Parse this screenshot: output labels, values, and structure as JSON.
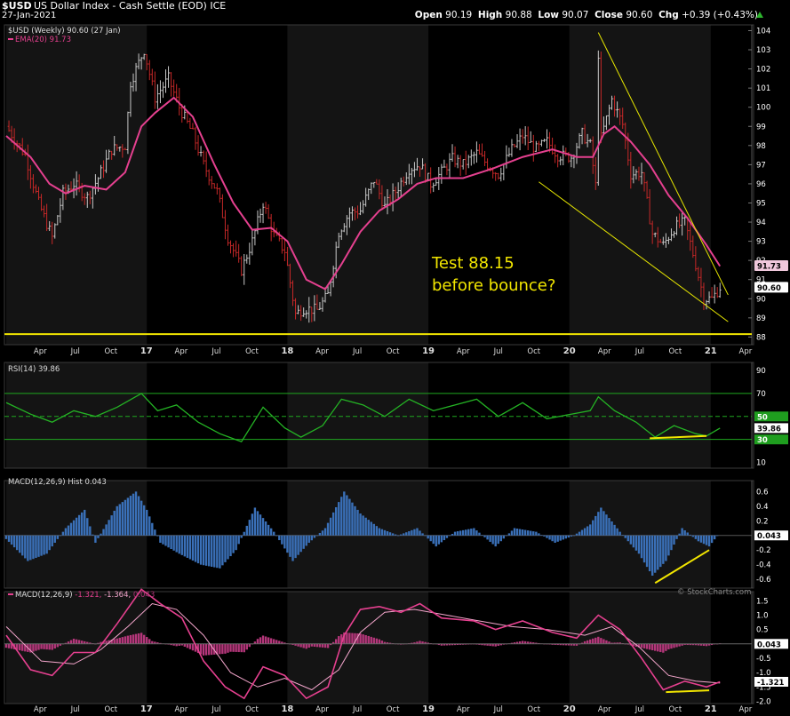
{
  "header": {
    "symbol": "$USD",
    "description": "US Dollar Index - Cash Settle (EOD)",
    "exchange": "ICE",
    "date": "27-Jan-2021",
    "open_label": "Open",
    "open": "90.19",
    "high_label": "High",
    "high": "90.88",
    "low_label": "Low",
    "low": "90.07",
    "close_label": "Close",
    "close": "90.60",
    "chg_label": "Chg",
    "chg": "+0.39 (+0.43%)",
    "watermark": "© StockCharts.com"
  },
  "chart_data": [
    {
      "panel": "price",
      "type": "ohlc-bar",
      "legend": [
        "$USD (Weekly) 90.60 (27 Jan)",
        "EMA(20) 91.73"
      ],
      "yticks": [
        88,
        89,
        90,
        91,
        92,
        93,
        94,
        95,
        96,
        97,
        98,
        99,
        100,
        101,
        102,
        103,
        104
      ],
      "ylim": [
        87.6,
        104.3
      ],
      "x_labels": [
        "Apr",
        "Jul",
        "Oct",
        "17",
        "Apr",
        "Jul",
        "Oct",
        "18",
        "Apr",
        "Jul",
        "Oct",
        "19",
        "Apr",
        "Jul",
        "Oct",
        "20",
        "Apr",
        "Jul",
        "Oct",
        "21",
        "Apr"
      ],
      "last_price_tag": "90.60",
      "ema_tag": "91.73",
      "support_level": 88.15,
      "annotation": [
        "Test 88.15",
        "before bounce?"
      ],
      "close_path": [
        [
          "2016-01-04",
          99.0
        ],
        [
          "2016-02-22",
          97.5
        ],
        [
          "2016-03-28",
          95.0
        ],
        [
          "2016-05-02",
          93.2
        ],
        [
          "2016-05-30",
          95.5
        ],
        [
          "2016-06-27",
          96.0
        ],
        [
          "2016-08-01",
          95.3
        ],
        [
          "2016-08-29",
          96.3
        ],
        [
          "2016-10-03",
          97.8
        ],
        [
          "2016-11-07",
          98.0
        ],
        [
          "2016-11-21",
          101.3
        ],
        [
          "2016-12-26",
          103.0
        ],
        [
          "2017-01-23",
          100.5
        ],
        [
          "2017-02-27",
          101.5
        ],
        [
          "2017-03-27",
          100.0
        ],
        [
          "2017-05-01",
          98.6
        ],
        [
          "2017-05-29",
          97.0
        ],
        [
          "2017-07-03",
          95.6
        ],
        [
          "2017-07-31",
          93.2
        ],
        [
          "2017-09-04",
          91.5
        ],
        [
          "2017-10-02",
          93.0
        ],
        [
          "2017-10-30",
          95.0
        ],
        [
          "2017-11-27",
          93.3
        ],
        [
          "2017-12-25",
          92.5
        ],
        [
          "2018-01-22",
          89.2
        ],
        [
          "2018-02-12",
          89.5
        ],
        [
          "2018-03-19",
          89.4
        ],
        [
          "2018-04-16",
          90.2
        ],
        [
          "2018-05-14",
          93.5
        ],
        [
          "2018-06-11",
          94.5
        ],
        [
          "2018-07-09",
          94.6
        ],
        [
          "2018-08-13",
          96.2
        ],
        [
          "2018-09-10",
          94.8
        ],
        [
          "2018-10-08",
          95.6
        ],
        [
          "2018-11-12",
          96.8
        ],
        [
          "2018-12-10",
          97.0
        ],
        [
          "2019-01-07",
          96.0
        ],
        [
          "2019-02-04",
          96.6
        ],
        [
          "2019-03-04",
          97.3
        ],
        [
          "2019-04-01",
          97.0
        ],
        [
          "2019-05-06",
          97.6
        ],
        [
          "2019-06-03",
          97.0
        ],
        [
          "2019-07-01",
          96.5
        ],
        [
          "2019-08-05",
          97.8
        ],
        [
          "2019-09-02",
          98.5
        ],
        [
          "2019-10-07",
          97.8
        ],
        [
          "2019-11-04",
          98.2
        ],
        [
          "2019-12-02",
          97.5
        ],
        [
          "2020-01-06",
          97.4
        ],
        [
          "2020-02-03",
          98.6
        ],
        [
          "2020-02-24",
          98.0
        ],
        [
          "2020-03-09",
          95.9
        ],
        [
          "2020-03-16",
          102.8
        ],
        [
          "2020-03-23",
          98.4
        ],
        [
          "2020-04-20",
          100.4
        ],
        [
          "2020-05-18",
          99.1
        ],
        [
          "2020-06-08",
          96.5
        ],
        [
          "2020-07-06",
          96.6
        ],
        [
          "2020-08-03",
          93.4
        ],
        [
          "2020-08-31",
          92.8
        ],
        [
          "2020-09-28",
          93.7
        ],
        [
          "2020-10-26",
          94.0
        ],
        [
          "2020-11-23",
          91.8
        ],
        [
          "2020-12-14",
          90.0
        ],
        [
          "2021-01-04",
          90.0
        ],
        [
          "2021-01-25",
          90.6
        ]
      ],
      "ema_path": [
        [
          "2016-01-04",
          98.5
        ],
        [
          "2016-03-07",
          97.4
        ],
        [
          "2016-04-25",
          96.0
        ],
        [
          "2016-06-06",
          95.5
        ],
        [
          "2016-07-25",
          95.9
        ],
        [
          "2016-09-19",
          95.7
        ],
        [
          "2016-11-07",
          96.6
        ],
        [
          "2016-12-19",
          99.0
        ],
        [
          "2017-01-23",
          99.7
        ],
        [
          "2017-03-13",
          100.5
        ],
        [
          "2017-05-01",
          99.5
        ],
        [
          "2017-06-26",
          97.0
        ],
        [
          "2017-08-14",
          95.0
        ],
        [
          "2017-10-02",
          93.6
        ],
        [
          "2017-11-20",
          93.7
        ],
        [
          "2018-01-01",
          93.0
        ],
        [
          "2018-02-19",
          91.0
        ],
        [
          "2018-04-09",
          90.5
        ],
        [
          "2018-05-21",
          91.8
        ],
        [
          "2018-07-09",
          93.5
        ],
        [
          "2018-08-27",
          94.6
        ],
        [
          "2018-10-15",
          95.2
        ],
        [
          "2018-12-03",
          96.0
        ],
        [
          "2019-01-21",
          96.3
        ],
        [
          "2019-04-01",
          96.3
        ],
        [
          "2019-06-17",
          96.8
        ],
        [
          "2019-09-02",
          97.4
        ],
        [
          "2019-11-18",
          97.8
        ],
        [
          "2020-01-20",
          97.4
        ],
        [
          "2020-03-02",
          97.4
        ],
        [
          "2020-03-30",
          98.6
        ],
        [
          "2020-04-27",
          99.0
        ],
        [
          "2020-06-08",
          98.2
        ],
        [
          "2020-07-27",
          97.0
        ],
        [
          "2020-09-14",
          95.4
        ],
        [
          "2020-11-02",
          94.2
        ],
        [
          "2020-12-21",
          92.8
        ],
        [
          "2021-01-25",
          91.7
        ]
      ],
      "trendline_upper": [
        [
          "2020-03-16",
          103.9
        ],
        [
          "2021-02-15",
          90.2
        ]
      ],
      "trendline_lower": [
        [
          "2019-10-14",
          96.1
        ],
        [
          "2021-02-15",
          88.8
        ]
      ]
    },
    {
      "panel": "rsi",
      "type": "line",
      "legend": "RSI(14) 39.86",
      "yticks": [
        10,
        30,
        50,
        70,
        90
      ],
      "ylim": [
        5,
        97
      ],
      "value_tags": [
        "50",
        "39.86",
        "30"
      ],
      "levels": [
        30,
        50,
        70
      ],
      "series": [
        [
          "2016-01-04",
          62
        ],
        [
          "2016-03-07",
          52
        ],
        [
          "2016-05-02",
          45
        ],
        [
          "2016-06-27",
          55
        ],
        [
          "2016-08-22",
          50
        ],
        [
          "2016-10-17",
          58
        ],
        [
          "2016-12-19",
          70
        ],
        [
          "2017-01-30",
          55
        ],
        [
          "2017-03-20",
          60
        ],
        [
          "2017-05-15",
          45
        ],
        [
          "2017-07-10",
          35
        ],
        [
          "2017-09-04",
          28
        ],
        [
          "2017-10-30",
          58
        ],
        [
          "2017-12-25",
          40
        ],
        [
          "2018-02-05",
          32
        ],
        [
          "2018-04-02",
          42
        ],
        [
          "2018-05-21",
          65
        ],
        [
          "2018-07-16",
          60
        ],
        [
          "2018-09-10",
          50
        ],
        [
          "2018-11-12",
          65
        ],
        [
          "2019-01-14",
          55
        ],
        [
          "2019-03-11",
          60
        ],
        [
          "2019-05-06",
          65
        ],
        [
          "2019-07-01",
          50
        ],
        [
          "2019-09-02",
          62
        ],
        [
          "2019-11-04",
          48
        ],
        [
          "2020-01-06",
          52
        ],
        [
          "2020-02-24",
          55
        ],
        [
          "2020-03-16",
          67
        ],
        [
          "2020-04-27",
          55
        ],
        [
          "2020-06-22",
          45
        ],
        [
          "2020-08-10",
          32
        ],
        [
          "2020-09-28",
          42
        ],
        [
          "2020-11-23",
          35
        ],
        [
          "2020-12-21",
          33
        ],
        [
          "2021-01-25",
          39.86
        ]
      ],
      "divergence_segment": [
        [
          "2020-07-27",
          31
        ],
        [
          "2020-12-21",
          33
        ]
      ]
    },
    {
      "panel": "macd_hist",
      "type": "bar",
      "legend": "MACD(12,26,9) Hist 0.043",
      "yticks": [
        -0.6,
        -0.4,
        -0.2,
        0,
        0.2,
        0.4,
        0.6
      ],
      "ylim": [
        -0.72,
        0.75
      ],
      "last_value_tag": "0.043",
      "series": [
        [
          "2016-01-04",
          -0.05
        ],
        [
          "2016-02-29",
          -0.35
        ],
        [
          "2016-04-18",
          -0.25
        ],
        [
          "2016-06-06",
          0.1
        ],
        [
          "2016-07-25",
          0.35
        ],
        [
          "2016-08-22",
          -0.1
        ],
        [
          "2016-10-17",
          0.4
        ],
        [
          "2016-12-05",
          0.6
        ],
        [
          "2017-01-02",
          0.35
        ],
        [
          "2017-02-06",
          -0.1
        ],
        [
          "2017-03-27",
          -0.25
        ],
        [
          "2017-05-22",
          -0.4
        ],
        [
          "2017-07-10",
          -0.45
        ],
        [
          "2017-08-21",
          -0.2
        ],
        [
          "2017-10-09",
          0.38
        ],
        [
          "2017-11-27",
          0.05
        ],
        [
          "2018-01-15",
          -0.35
        ],
        [
          "2018-02-26",
          -0.1
        ],
        [
          "2018-04-09",
          0.1
        ],
        [
          "2018-05-28",
          0.6
        ],
        [
          "2018-07-09",
          0.3
        ],
        [
          "2018-08-27",
          0.1
        ],
        [
          "2018-10-15",
          0.0
        ],
        [
          "2018-12-03",
          0.1
        ],
        [
          "2019-01-21",
          -0.15
        ],
        [
          "2019-03-11",
          0.05
        ],
        [
          "2019-04-29",
          0.1
        ],
        [
          "2019-06-24",
          -0.15
        ],
        [
          "2019-08-12",
          0.1
        ],
        [
          "2019-10-07",
          0.05
        ],
        [
          "2019-11-25",
          -0.1
        ],
        [
          "2020-01-13",
          0.0
        ],
        [
          "2020-02-24",
          0.15
        ],
        [
          "2020-03-23",
          0.38
        ],
        [
          "2020-05-11",
          0.05
        ],
        [
          "2020-06-29",
          -0.25
        ],
        [
          "2020-08-03",
          -0.55
        ],
        [
          "2020-09-07",
          -0.35
        ],
        [
          "2020-10-19",
          0.1
        ],
        [
          "2020-11-30",
          -0.08
        ],
        [
          "2020-12-28",
          -0.15
        ],
        [
          "2021-01-25",
          0.043
        ]
      ],
      "divergence_segment": [
        [
          "2020-08-10",
          -0.65
        ],
        [
          "2020-12-28",
          -0.2
        ]
      ]
    },
    {
      "panel": "macd",
      "type": "line",
      "legend": [
        "MACD(12,26,9)",
        "-1.321",
        "-1.364",
        "0.043"
      ],
      "yticks": [
        -2.0,
        -1.5,
        -1.0,
        -0.5,
        0,
        0.5,
        1.0,
        1.5
      ],
      "ylim": [
        -2.08,
        1.82
      ],
      "value_tags": [
        "0.043",
        "-1.321"
      ],
      "macd": [
        [
          "2016-01-04",
          0.3
        ],
        [
          "2016-03-07",
          -0.9
        ],
        [
          "2016-05-02",
          -1.1
        ],
        [
          "2016-06-27",
          -0.3
        ],
        [
          "2016-08-22",
          -0.3
        ],
        [
          "2016-10-17",
          0.7
        ],
        [
          "2016-12-19",
          1.9
        ],
        [
          "2017-02-06",
          1.4
        ],
        [
          "2017-04-03",
          0.9
        ],
        [
          "2017-05-29",
          -0.6
        ],
        [
          "2017-07-24",
          -1.5
        ],
        [
          "2017-09-11",
          -1.9
        ],
        [
          "2017-10-30",
          -0.8
        ],
        [
          "2017-12-25",
          -1.1
        ],
        [
          "2018-02-19",
          -1.9
        ],
        [
          "2018-04-16",
          -1.5
        ],
        [
          "2018-05-28",
          0.3
        ],
        [
          "2018-07-09",
          1.2
        ],
        [
          "2018-08-27",
          1.3
        ],
        [
          "2018-10-22",
          1.1
        ],
        [
          "2018-12-10",
          1.4
        ],
        [
          "2019-02-04",
          0.9
        ],
        [
          "2019-04-29",
          0.8
        ],
        [
          "2019-06-24",
          0.5
        ],
        [
          "2019-09-02",
          0.8
        ],
        [
          "2019-11-18",
          0.4
        ],
        [
          "2020-01-20",
          0.2
        ],
        [
          "2020-03-16",
          1.0
        ],
        [
          "2020-05-11",
          0.5
        ],
        [
          "2020-07-06",
          -0.5
        ],
        [
          "2020-08-31",
          -1.6
        ],
        [
          "2020-10-26",
          -1.3
        ],
        [
          "2020-12-21",
          -1.5
        ],
        [
          "2021-01-25",
          -1.321
        ]
      ],
      "signal": [
        [
          "2016-01-04",
          0.6
        ],
        [
          "2016-04-04",
          -0.6
        ],
        [
          "2016-06-27",
          -0.7
        ],
        [
          "2016-09-05",
          -0.2
        ],
        [
          "2016-11-14",
          0.6
        ],
        [
          "2017-01-16",
          1.4
        ],
        [
          "2017-03-20",
          1.2
        ],
        [
          "2017-05-29",
          0.3
        ],
        [
          "2017-08-07",
          -1.0
        ],
        [
          "2017-10-16",
          -1.5
        ],
        [
          "2017-12-25",
          -1.2
        ],
        [
          "2018-03-05",
          -1.6
        ],
        [
          "2018-05-14",
          -0.9
        ],
        [
          "2018-07-09",
          0.4
        ],
        [
          "2018-09-10",
          1.1
        ],
        [
          "2018-11-26",
          1.2
        ],
        [
          "2019-02-18",
          1.0
        ],
        [
          "2019-05-13",
          0.8
        ],
        [
          "2019-08-05",
          0.6
        ],
        [
          "2019-11-04",
          0.5
        ],
        [
          "2020-02-10",
          0.3
        ],
        [
          "2020-04-20",
          0.6
        ],
        [
          "2020-06-29",
          -0.1
        ],
        [
          "2020-09-14",
          -1.1
        ],
        [
          "2020-11-23",
          -1.3
        ],
        [
          "2021-01-25",
          -1.364
        ]
      ],
      "divergence_segment": [
        [
          "2020-09-07",
          -1.68
        ],
        [
          "2020-12-28",
          -1.62
        ]
      ]
    }
  ],
  "colors": {
    "background": "#000000",
    "band_alt": "#141414",
    "bar_up": "#c8c8c8",
    "bar_down": "#c62828",
    "ema": "#e5408f",
    "trendline": "#e6e600",
    "support": "#f2e600",
    "rsi": "#24b324",
    "rsi_guides": "#1fa81f",
    "hist": "#3a70b8",
    "macd_line": "#e5408f",
    "macd_hist": "#b4367a",
    "tag_bg": "#ffffff",
    "annotation": "#f2e600"
  }
}
